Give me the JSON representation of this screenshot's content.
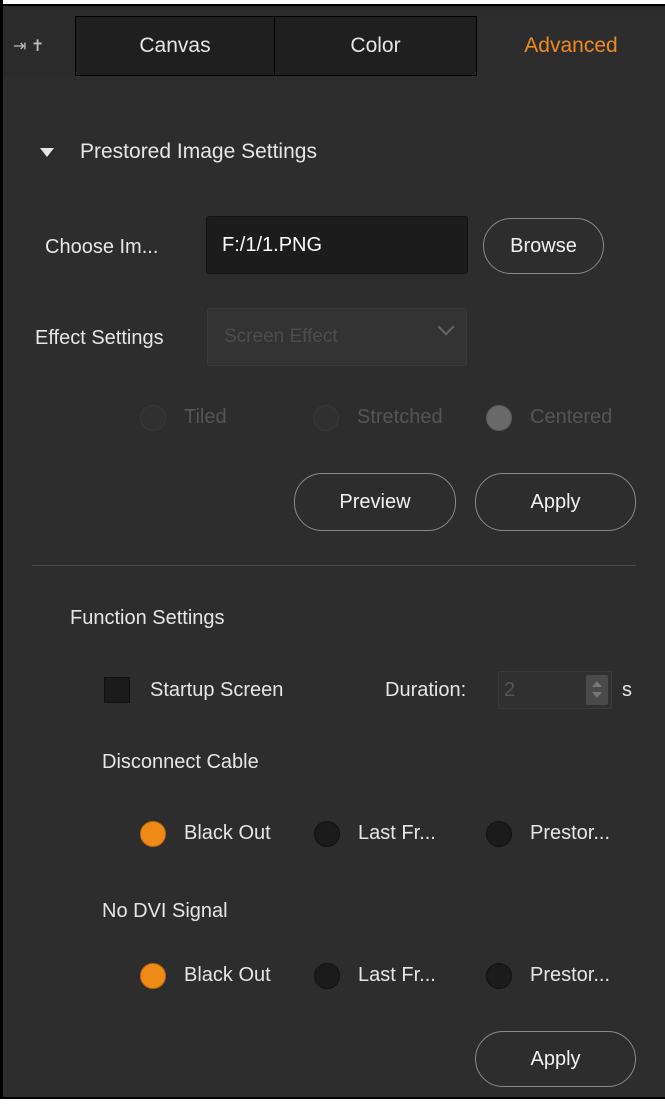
{
  "tabs": {
    "canvas": "Canvas",
    "color": "Color",
    "advanced": "Advanced"
  },
  "prestored": {
    "header": "Prestored Image Settings",
    "choose_label": "Choose Im...",
    "path_value": "F:/1/1.PNG",
    "browse": "Browse",
    "effect_label": "Effect Settings",
    "effect_value": "Screen Effect",
    "options": {
      "tiled": "Tiled",
      "stretched": "Stretched",
      "centered": "Centered"
    },
    "preview": "Preview",
    "apply": "Apply"
  },
  "function": {
    "header": "Function Settings",
    "startup_label": "Startup Screen",
    "duration_label": "Duration:",
    "duration_value": "2",
    "duration_unit": "s",
    "disconnect": {
      "label": "Disconnect Cable",
      "options": [
        "Black Out",
        "Last Fr...",
        "Prestor..."
      ]
    },
    "no_dvi": {
      "label": "No DVI Signal",
      "options": [
        "Black Out",
        "Last Fr...",
        "Prestor..."
      ]
    },
    "apply": "Apply"
  },
  "colors": {
    "accent": "#ef8a22",
    "background": "#2d2d2d"
  }
}
